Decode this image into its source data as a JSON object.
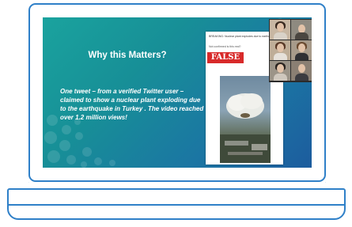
{
  "slide": {
    "title": "Why this Matters?",
    "body": "One tweet – from a verified Twitter user – claimed to show a nuclear plant exploding due to the earthquake in Turkey . The video reached over 1.2 million views!"
  },
  "tweet": {
    "header": "BREAKING: Nuclear plant explodes due to earthquake",
    "text": "Not confirmed is this real?",
    "badge": "FALSE"
  },
  "colors": {
    "laptop_outline": "#2f80c8",
    "false_badge": "#d82a2a"
  }
}
